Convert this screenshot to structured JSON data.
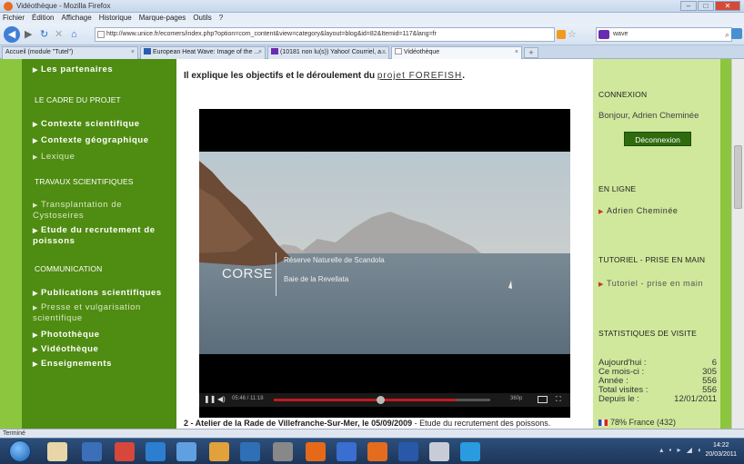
{
  "window": {
    "title": "Vidéothèque - Mozilla Firefox"
  },
  "menubar": {
    "items": [
      "Fichier",
      "Édition",
      "Affichage",
      "Historique",
      "Marque-pages",
      "Outils",
      "?"
    ]
  },
  "navbar": {
    "url": "http://www.unice.fr/ecomers/index.php?option=com_content&view=category&layout=blog&id=82&Itemid=117&lang=fr",
    "search_value": "wave"
  },
  "tabs": [
    {
      "label": "Accueil (module \"Tutel\")",
      "active": false
    },
    {
      "label": "European Heat Wave: Image of the ...",
      "active": false
    },
    {
      "label": "(10181 non lu(s)) Yahoo! Courriel, a...",
      "active": false
    },
    {
      "label": "Vidéothèque",
      "active": true
    }
  ],
  "sidebar": {
    "items_top": [
      {
        "label": "Les partenaires"
      }
    ],
    "sections": [
      {
        "title": "LE CADRE DU PROJET"
      },
      {
        "title": "TRAVAUX SCIENTIFIQUES"
      },
      {
        "title": "COMMUNICATION"
      }
    ],
    "cadre": [
      "Contexte scientifique",
      "Contexte géographique",
      "Lexique"
    ],
    "travaux": [
      {
        "label": "Transplantation de Cystoseires"
      },
      {
        "label": "Etude du recrutement de poissons"
      }
    ],
    "communication": [
      "Publications scientifiques",
      "Presse et vulgarisation scientifique",
      "Photothèque",
      "Vidéothèque",
      "Enseignements"
    ]
  },
  "main": {
    "intro_text": "Il explique les objectifs et le déroulement du",
    "intro_link": "projet FOREFISH",
    "intro_end": ".",
    "video": {
      "overlay_title": "CORSE",
      "overlay_line1": "Réserve Naturelle de Scandola",
      "overlay_line2": "Baie de la Revellata",
      "time": "05:46 / 11:18",
      "quality": "360p",
      "progress": 0.49,
      "buffered": 0.84
    },
    "bottom_bold": "2 - Atelier de la Rade de Villefranche-Sur-Mer, le 05/09/2009",
    "bottom_text": "- Etude du recrutement des poissons."
  },
  "right": {
    "connexion_title": "CONNEXION",
    "greeting": "Bonjour, Adrien Cheminée",
    "logout_label": "Déconnexion",
    "online_title": "EN LIGNE",
    "online_user": "Adrien Cheminée",
    "tutorial_title": "TUTORIEL - PRISE EN MAIN",
    "tutorial_link": "Tutoriel - prise en main",
    "stats_title": "STATISTIQUES DE VISITE",
    "stats": [
      {
        "label": "Aujourd'hui :",
        "value": "6"
      },
      {
        "label": "Ce mois-ci :",
        "value": "305"
      },
      {
        "label": "Année :",
        "value": "556"
      },
      {
        "label": "Total visites :",
        "value": "556"
      },
      {
        "label": "Depuis le :",
        "value": "12/01/2011"
      }
    ],
    "country": "78% France (432)"
  },
  "statusbar": {
    "text": "Terminé"
  },
  "taskbar": {
    "time": "14:22",
    "date": "20/03/2011"
  },
  "colors": {
    "sidebar_bg": "#4f8c12",
    "frame_green": "#8cc63f",
    "right_bg": "#cfe89b",
    "logout_bg": "#2f6b0e",
    "progress_red": "#c41a1a"
  }
}
